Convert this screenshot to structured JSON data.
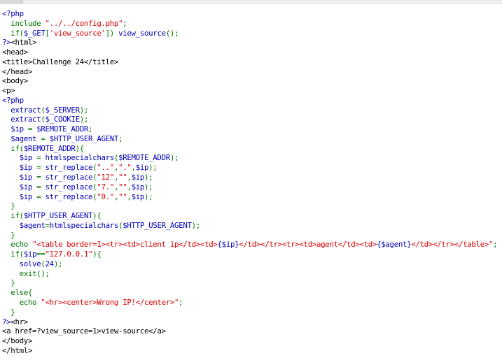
{
  "source_lines": [
    [
      [
        "php",
        "<?php"
      ]
    ],
    [
      [
        "kw",
        "  include "
      ],
      [
        "str",
        "\"../../config.php\""
      ],
      [
        "kw",
        ";"
      ]
    ],
    [
      [
        "kw",
        "  if("
      ],
      [
        "php",
        "$_GET"
      ],
      [
        "kw",
        "["
      ],
      [
        "str",
        "'view_source'"
      ],
      [
        "kw",
        "]) "
      ],
      [
        "php",
        "view_source"
      ],
      [
        "kw",
        "();"
      ]
    ],
    [
      [
        "php",
        "?>"
      ],
      [
        "html",
        "<html>"
      ]
    ],
    [
      [
        "html",
        "<head>"
      ]
    ],
    [
      [
        "html",
        "<title>Challenge 24</title>"
      ]
    ],
    [
      [
        "html",
        "</head>"
      ]
    ],
    [
      [
        "html",
        "<body>"
      ]
    ],
    [
      [
        "html",
        "<p>"
      ]
    ],
    [
      [
        "php",
        "<?php"
      ]
    ],
    [
      [
        "php",
        "  extract"
      ],
      [
        "kw",
        "("
      ],
      [
        "php",
        "$_SERVER"
      ],
      [
        "kw",
        ");"
      ]
    ],
    [
      [
        "php",
        "  extract"
      ],
      [
        "kw",
        "("
      ],
      [
        "php",
        "$_COOKIE"
      ],
      [
        "kw",
        ");"
      ]
    ],
    [
      [
        "php",
        "  $ip "
      ],
      [
        "kw",
        "= "
      ],
      [
        "php",
        "$REMOTE_ADDR"
      ],
      [
        "kw",
        ";"
      ]
    ],
    [
      [
        "php",
        "  $agent "
      ],
      [
        "kw",
        "= "
      ],
      [
        "php",
        "$HTTP_USER_AGENT"
      ],
      [
        "kw",
        ";"
      ]
    ],
    [
      [
        "kw",
        "  if("
      ],
      [
        "php",
        "$REMOTE_ADDR"
      ],
      [
        "kw",
        "){"
      ]
    ],
    [
      [
        "php",
        "    $ip "
      ],
      [
        "kw",
        "= "
      ],
      [
        "php",
        "htmlspecialchars"
      ],
      [
        "kw",
        "("
      ],
      [
        "php",
        "$REMOTE_ADDR"
      ],
      [
        "kw",
        ");"
      ]
    ],
    [
      [
        "php",
        "    $ip "
      ],
      [
        "kw",
        "= "
      ],
      [
        "php",
        "str_replace"
      ],
      [
        "kw",
        "("
      ],
      [
        "str",
        "\"..\""
      ],
      [
        "kw",
        ","
      ],
      [
        "str",
        "\".\""
      ],
      [
        "kw",
        ","
      ],
      [
        "php",
        "$ip"
      ],
      [
        "kw",
        ");"
      ]
    ],
    [
      [
        "php",
        "    $ip "
      ],
      [
        "kw",
        "= "
      ],
      [
        "php",
        "str_replace"
      ],
      [
        "kw",
        "("
      ],
      [
        "str",
        "\"12\""
      ],
      [
        "kw",
        ","
      ],
      [
        "str",
        "\"\""
      ],
      [
        "kw",
        ","
      ],
      [
        "php",
        "$ip"
      ],
      [
        "kw",
        ");"
      ]
    ],
    [
      [
        "php",
        "    $ip "
      ],
      [
        "kw",
        "= "
      ],
      [
        "php",
        "str_replace"
      ],
      [
        "kw",
        "("
      ],
      [
        "str",
        "\"7.\""
      ],
      [
        "kw",
        ","
      ],
      [
        "str",
        "\"\""
      ],
      [
        "kw",
        ","
      ],
      [
        "php",
        "$ip"
      ],
      [
        "kw",
        ");"
      ]
    ],
    [
      [
        "php",
        "    $ip "
      ],
      [
        "kw",
        "= "
      ],
      [
        "php",
        "str_replace"
      ],
      [
        "kw",
        "("
      ],
      [
        "str",
        "\"0.\""
      ],
      [
        "kw",
        ","
      ],
      [
        "str",
        "\"\""
      ],
      [
        "kw",
        ","
      ],
      [
        "php",
        "$ip"
      ],
      [
        "kw",
        ");"
      ]
    ],
    [
      [
        "kw",
        "  }"
      ]
    ],
    [
      [
        "kw",
        "  if("
      ],
      [
        "php",
        "$HTTP_USER_AGENT"
      ],
      [
        "kw",
        "){"
      ]
    ],
    [
      [
        "php",
        "    $agent"
      ],
      [
        "kw",
        "="
      ],
      [
        "php",
        "htmlspecialchars"
      ],
      [
        "kw",
        "("
      ],
      [
        "php",
        "$HTTP_USER_AGENT"
      ],
      [
        "kw",
        ");"
      ]
    ],
    [
      [
        "kw",
        "  }"
      ]
    ],
    [
      [
        "kw",
        "  echo "
      ],
      [
        "str",
        "\"<table border=1><tr><td>client ip</td><td>"
      ],
      [
        "php",
        "{$ip}"
      ],
      [
        "str",
        "</td></tr><tr><td>agent</td><td>"
      ],
      [
        "php",
        "{$agent}"
      ],
      [
        "str",
        "</td></tr></table>\""
      ],
      [
        "kw",
        ";"
      ]
    ],
    [
      [
        "kw",
        "  if("
      ],
      [
        "php",
        "$ip"
      ],
      [
        "kw",
        "=="
      ],
      [
        "str",
        "\"127.0.0.1\""
      ],
      [
        "kw",
        "){"
      ]
    ],
    [
      [
        "php",
        "    solve"
      ],
      [
        "kw",
        "("
      ],
      [
        "php",
        "24"
      ],
      [
        "kw",
        ");"
      ]
    ],
    [
      [
        "kw",
        "    exit();"
      ]
    ],
    [
      [
        "kw",
        "  }"
      ]
    ],
    [
      [
        "kw",
        "  else{"
      ]
    ],
    [
      [
        "kw",
        "    echo "
      ],
      [
        "str",
        "\"<hr><center>Wrong IP!</center>\""
      ],
      [
        "kw",
        ";"
      ]
    ],
    [
      [
        "kw",
        "  }"
      ]
    ],
    [
      [
        "php",
        "?>"
      ],
      [
        "html",
        "<hr>"
      ]
    ],
    [
      [
        "html",
        "<a href=?view_source=1>view-source</a>"
      ]
    ],
    [
      [
        "html",
        "</body>"
      ]
    ],
    [
      [
        "html",
        "</html>"
      ]
    ]
  ]
}
